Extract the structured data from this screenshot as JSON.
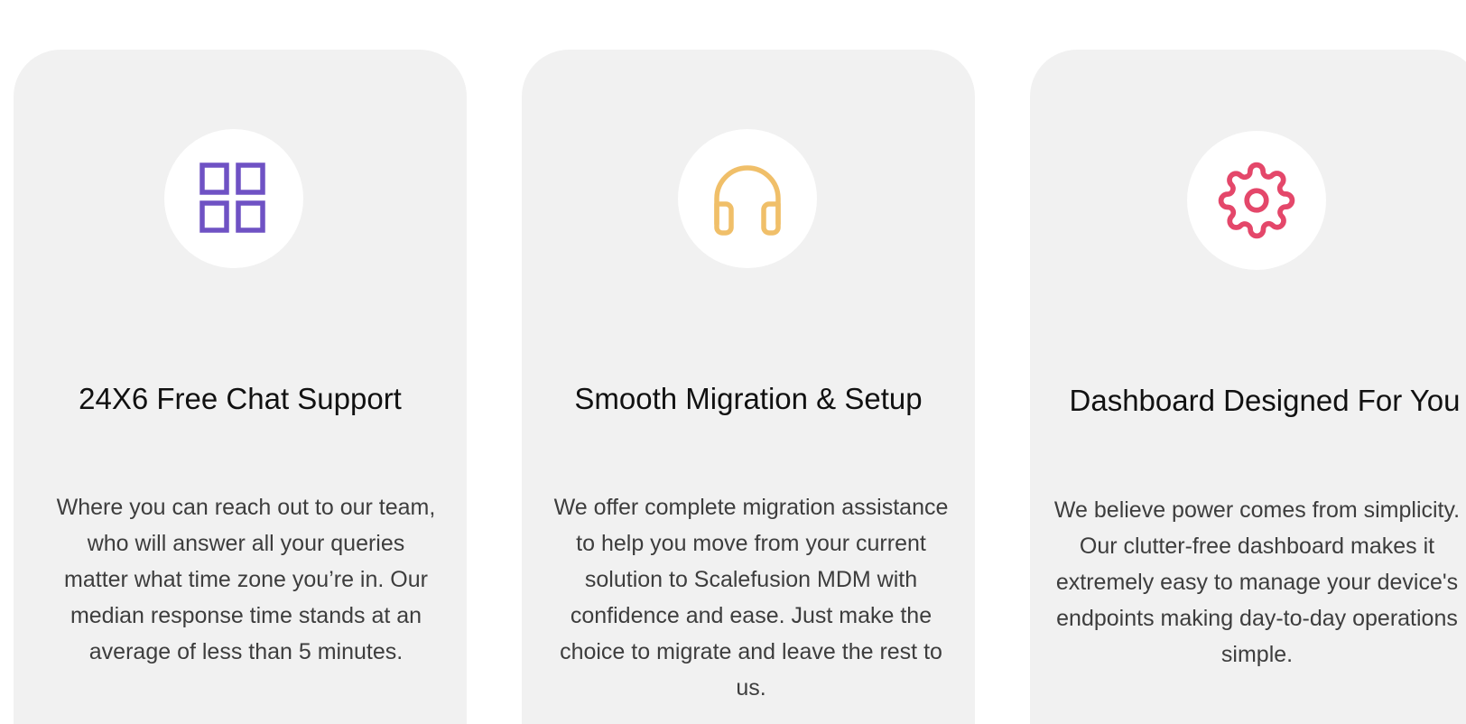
{
  "features": [
    {
      "icon": "grid-icon",
      "icon_color": "#6f52c4",
      "title": "24X6 Free Chat Support",
      "description": "Where you can reach out to our team, who will answer all your queries matter what time zone you’re in. Our median response time stands at an average of less than 5 minutes."
    },
    {
      "icon": "headphones-icon",
      "icon_color": "#f0bf69",
      "title": "Smooth Migration & Setup",
      "description": "We offer complete migration assistance to help you move from your current solution to Scalefusion MDM with confidence and ease. Just make the choice to migrate and leave the rest to us."
    },
    {
      "icon": "gear-icon",
      "icon_color": "#e4476a",
      "title": "Dashboard Designed For You",
      "description": "We believe power comes from simplicity. Our clutter-free dashboard makes it extremely easy to manage your device's endpoints making day-to-day operations simple."
    }
  ]
}
